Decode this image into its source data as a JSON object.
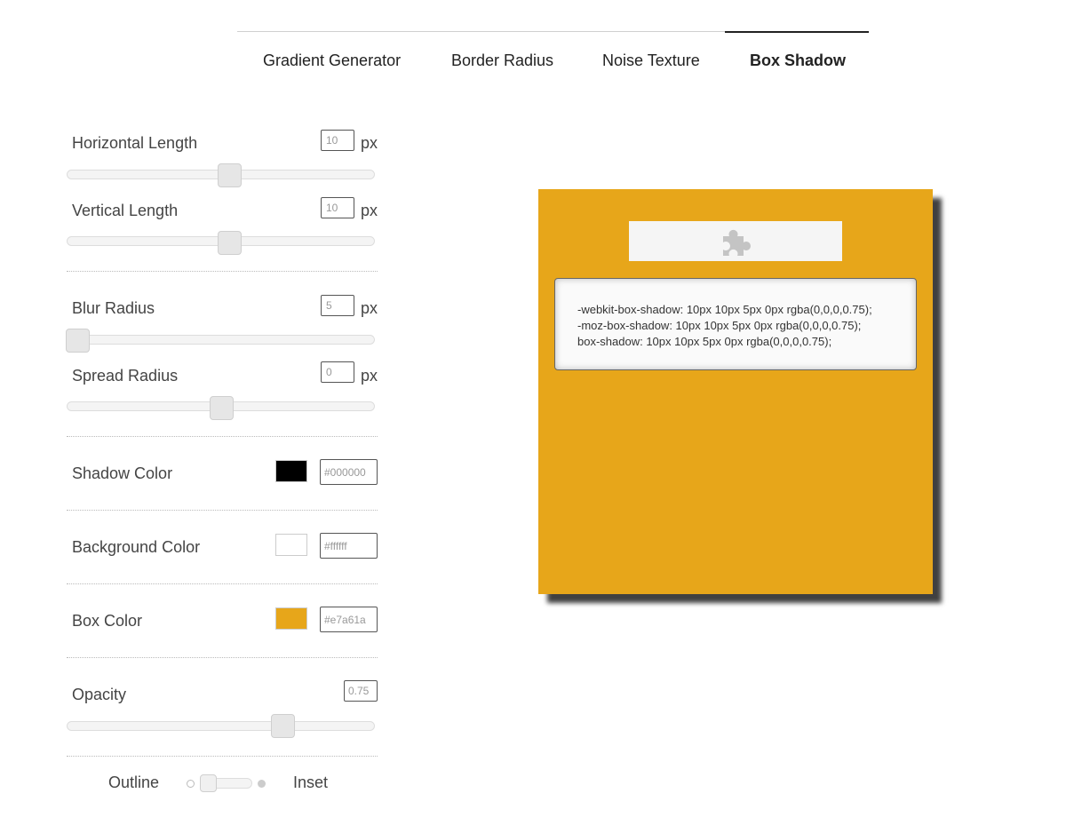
{
  "nav": {
    "tabs": [
      {
        "label": "Gradient Generator",
        "active": false
      },
      {
        "label": "Border Radius",
        "active": false
      },
      {
        "label": "Noise Texture",
        "active": false
      },
      {
        "label": "Box Shadow",
        "active": true
      }
    ]
  },
  "controls": {
    "unit": "px",
    "horizontal_length": {
      "label": "Horizontal Length",
      "value": "10"
    },
    "vertical_length": {
      "label": "Vertical Length",
      "value": "10"
    },
    "blur_radius": {
      "label": "Blur Radius",
      "value": "5"
    },
    "spread_radius": {
      "label": "Spread Radius",
      "value": "0"
    },
    "shadow_color": {
      "label": "Shadow Color",
      "hex": "#000000",
      "color": "#000000"
    },
    "background_color": {
      "label": "Background Color",
      "hex": "#ffffff",
      "color": "#ffffff"
    },
    "box_color": {
      "label": "Box Color",
      "hex": "#e7a61a",
      "color": "#e7a61a"
    },
    "opacity": {
      "label": "Opacity",
      "value": "0.75"
    },
    "toggle": {
      "outline_label": "Outline",
      "inset_label": "Inset",
      "selected": "Outline"
    }
  },
  "preview": {
    "box_color": "#e7a61a",
    "icon": "puzzle-piece-icon",
    "code_lines": [
      "-webkit-box-shadow: 10px 10px 5px 0px rgba(0,0,0,0.75);",
      "-moz-box-shadow: 10px 10px 5px 0px rgba(0,0,0,0.75);",
      "box-shadow: 10px 10px 5px 0px rgba(0,0,0,0.75);"
    ]
  }
}
